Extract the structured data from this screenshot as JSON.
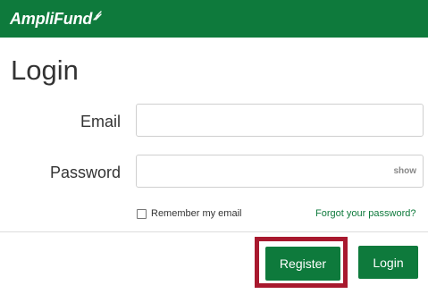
{
  "header": {
    "logo_text": "AmpliFund"
  },
  "login": {
    "title": "Login",
    "email_label": "Email",
    "email_value": "",
    "password_label": "Password",
    "password_value": "",
    "show_label": "show",
    "remember_label": "Remember my email",
    "remember_checked": false,
    "forgot_label": "Forgot your password?",
    "register_label": "Register",
    "login_label": "Login"
  },
  "colors": {
    "brand": "#0e7a3c",
    "highlight": "#a8192e"
  },
  "icons": {
    "logo_mark": "signal-lines-icon"
  }
}
